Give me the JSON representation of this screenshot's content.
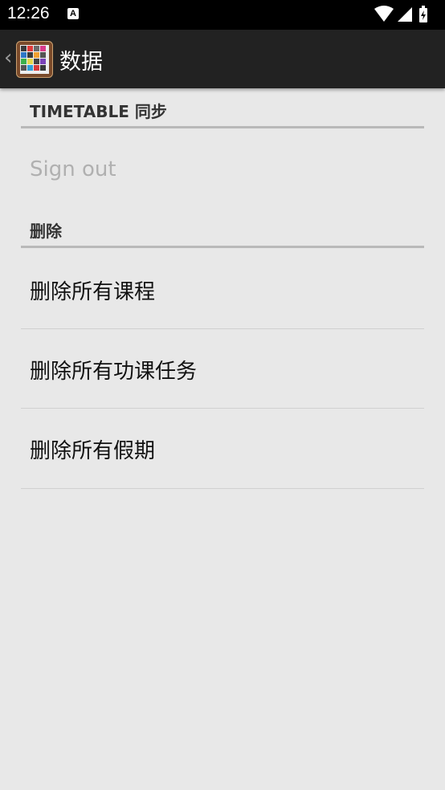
{
  "status_bar": {
    "time": "12:26",
    "notification_icon": "A"
  },
  "action_bar": {
    "title": "数据"
  },
  "sections": [
    {
      "header": "TIMETABLE 同步"
    },
    {
      "header": "删除"
    }
  ],
  "prefs": {
    "sign_out": "Sign out",
    "delete_courses": "删除所有课程",
    "delete_homework": "删除所有功课任务",
    "delete_holidays": "删除所有假期"
  }
}
